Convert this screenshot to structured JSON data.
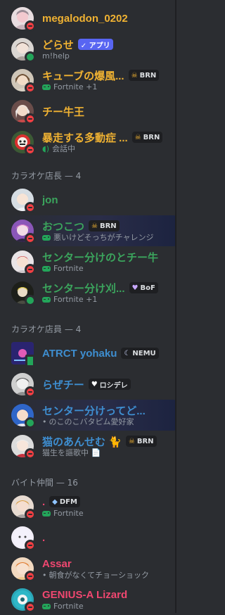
{
  "colors": {
    "gold": "#f0b232",
    "green": "#3ba55d",
    "blue": "#3e8ed0",
    "red": "#f23f43",
    "pink": "#f04770"
  },
  "sections": {
    "karaoke_manager": "カラオケ店長 — 4",
    "karaoke_staff": "カラオケ店員 — 4",
    "part_time": "バイト仲間 — 16"
  },
  "members": [
    {
      "name": "megalodon_0202",
      "status": "dnd"
    },
    {
      "name": "どらせ",
      "tag": "✓ アプリ",
      "sub": "m!help",
      "status": "online"
    },
    {
      "name": "キューブの爆風...",
      "tag": "BRN",
      "tag_icon": "skull-icon",
      "sub": "Fortnite +1",
      "sub_icon": "gamepad-icon",
      "status": "dnd"
    },
    {
      "name": "チー牛王",
      "status": "dnd"
    },
    {
      "name": "暴走する多動症 ...",
      "tag": "BRN",
      "tag_icon": "skull-icon",
      "sub": "会話中",
      "sub_icon": "voice-icon",
      "status": "dnd"
    },
    {
      "name": "jon",
      "status": "dnd"
    },
    {
      "name": "おつこつ",
      "tag": "BRN",
      "tag_icon": "skull-icon",
      "sub": "悪いけどそっちがチャレンジ",
      "sub_icon": "gamepad-icon",
      "status": "dnd"
    },
    {
      "name": "センター分けのとチー牛",
      "sub": "Fortnite",
      "sub_icon": "gamepad-icon",
      "status": "dnd"
    },
    {
      "name": "センター分け刈...",
      "tag": "BoF",
      "tag_icon": "heart-icon",
      "sub": "Fortnite +1",
      "sub_icon": "gamepad-icon",
      "status": "online"
    },
    {
      "name": "ATRCT yohaku",
      "tag": "NEMU",
      "tag_icon": "moon-icon",
      "status": "mobile"
    },
    {
      "name": "らぜチー",
      "tag": "ロシデレ",
      "tag_icon": "heart-icon",
      "status": "dnd"
    },
    {
      "name": "センター分けってど...",
      "sub": "のこのこバタピム愛好家",
      "sub_icon": "dot",
      "status": "online"
    },
    {
      "name": "猫のあんせむ 🐈",
      "tag": "BRN",
      "tag_icon": "skull-icon",
      "sub": "猫生を謳歌中 📄",
      "status": "dnd"
    },
    {
      "name": ".",
      "tag": "DFM",
      "tag_icon": "diamond-icon",
      "sub": "Fortnite",
      "sub_icon": "gamepad-icon",
      "status": "dnd"
    },
    {
      "name": ".",
      "status": "dnd"
    },
    {
      "name": "Assar",
      "sub": "朝食がなくてチョーショック",
      "sub_icon": "dot",
      "status": "dnd"
    },
    {
      "name": "GENIUS-A Lizard",
      "sub": "Fortnite",
      "sub_icon": "gamepad-icon",
      "status": "dnd"
    }
  ]
}
